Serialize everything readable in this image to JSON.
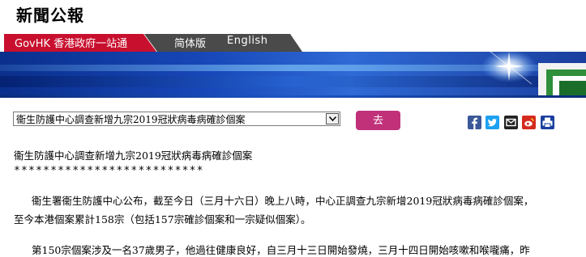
{
  "masthead": {
    "title": "新聞公報"
  },
  "nav": {
    "govhk_label": "GovHK 香港政府一站通",
    "simplified_label": "简体版",
    "english_label": "English"
  },
  "toolbar": {
    "select_value": "衞生防護中心調查新增九宗2019冠狀病毒病確診個案",
    "go_label": "去"
  },
  "share": {
    "icons": [
      {
        "name": "facebook-icon",
        "color": "#3b5998",
        "glyph": "f"
      },
      {
        "name": "twitter-icon",
        "color": "#1da1f2",
        "glyph": "t"
      },
      {
        "name": "email-icon",
        "color": "#222222",
        "glyph": "✉"
      },
      {
        "name": "weibo-icon",
        "color": "#d52b1e",
        "glyph": "w"
      },
      {
        "name": "print-icon",
        "color": "#1a3f9e",
        "glyph": "⎙"
      }
    ]
  },
  "article": {
    "headline": "衞生防護中心調查新增九宗2019冠狀病毒病確診個案",
    "stars": "**************************",
    "para1_line1": "衞生署衞生防護中心公布，截至今日（三月十六日）晚上八時，中心正調查九宗新增2019冠狀病毒病確診個案，",
    "para1_line2": "至今本港個案累計158宗（包括157宗確診個案和一宗疑似個案）。",
    "para2_line1": "第150宗個案涉及一名37歲男子，他過往健康良好，自三月十三日開始發燒，三月十四日開始咳嗽和喉嚨痛，昨"
  }
}
